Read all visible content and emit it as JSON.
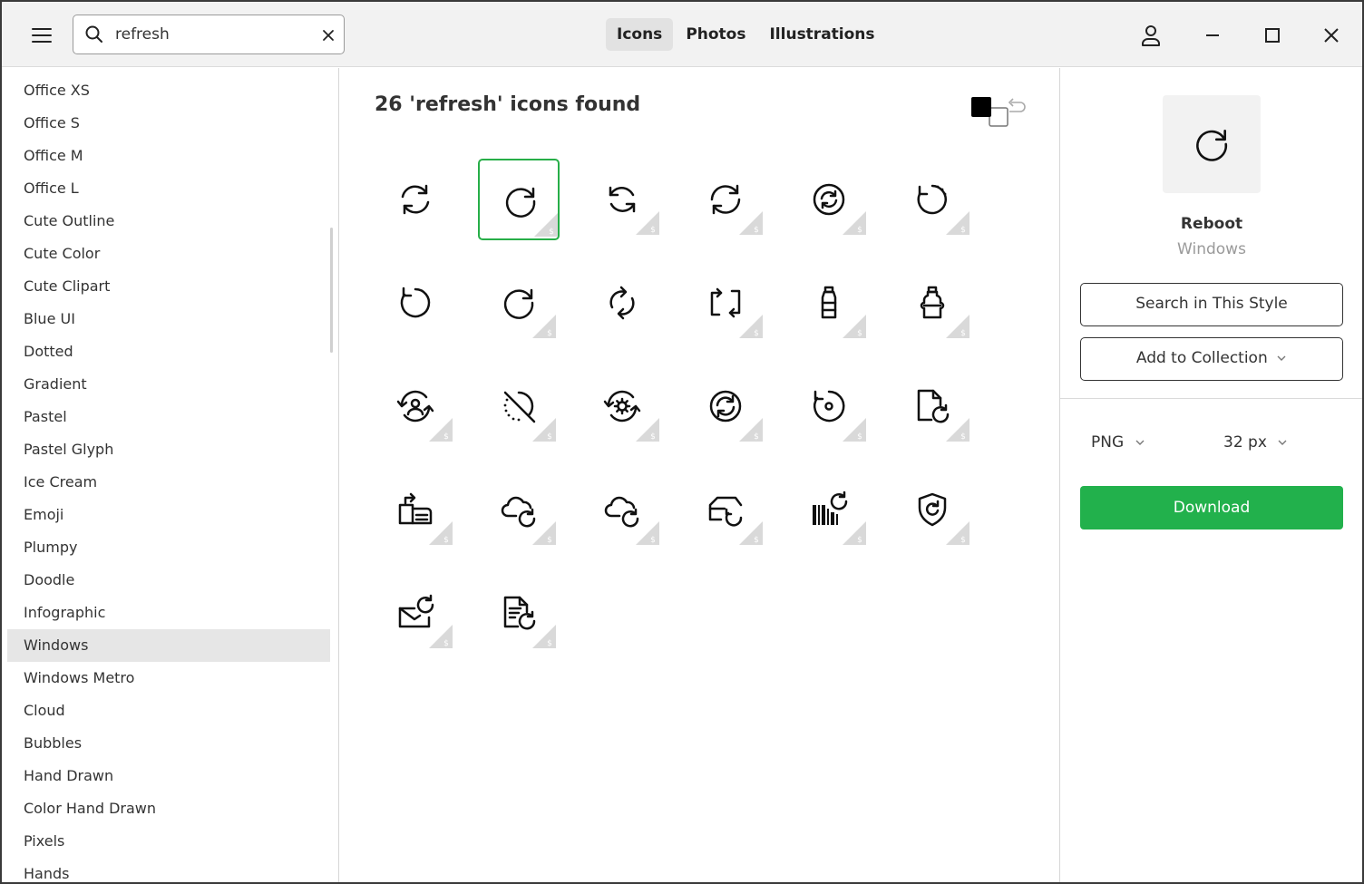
{
  "search": {
    "value": "refresh"
  },
  "tabs": [
    {
      "label": "Icons",
      "active": true
    },
    {
      "label": "Photos",
      "active": false
    },
    {
      "label": "Illustrations",
      "active": false
    }
  ],
  "sidebar": {
    "items": [
      "Office XS",
      "Office S",
      "Office M",
      "Office L",
      "Cute Outline",
      "Cute Color",
      "Cute Clipart",
      "Blue UI",
      "Dotted",
      "Gradient",
      "Pastel",
      "Pastel Glyph",
      "Ice Cream",
      "Emoji",
      "Plumpy",
      "Doodle",
      "Infographic",
      "Windows",
      "Windows Metro",
      "Cloud",
      "Bubbles",
      "Hand Drawn",
      "Color Hand Drawn",
      "Pixels",
      "Hands"
    ],
    "active": "Windows"
  },
  "results": {
    "title": "26 'refresh' icons found",
    "icons": [
      "sync-arrows-icon",
      "reboot-icon",
      "sync-open-icon",
      "sync-icon",
      "circular-sync-icon",
      "dotted-restart-icon",
      "power-restart-icon",
      "redo-circle-icon",
      "rotate-arrows-icon",
      "repeat-square-icon",
      "bottle-icon",
      "bottle-alt-icon",
      "user-sync-icon",
      "sync-disabled-icon",
      "gear-sync-icon",
      "sync-circle-icon",
      "undo-circle-icon",
      "file-refresh-icon",
      "printer-refresh-icon",
      "cloud-refresh-icon",
      "cloud-sync-icon",
      "cart-refresh-icon",
      "barcode-refresh-icon",
      "shield-refresh-icon",
      "mail-refresh-icon",
      "document-refresh-icon"
    ],
    "selected_index": 1
  },
  "detail": {
    "name": "Reboot",
    "style": "Windows",
    "search_style_label": "Search in This Style",
    "collection_label": "Add to Collection",
    "format": "PNG",
    "size": "32 px",
    "download_label": "Download"
  },
  "colors": {
    "accent": "#22b14c",
    "selected_border": "#27ae48",
    "paid_badge": "#d9d9d9"
  }
}
